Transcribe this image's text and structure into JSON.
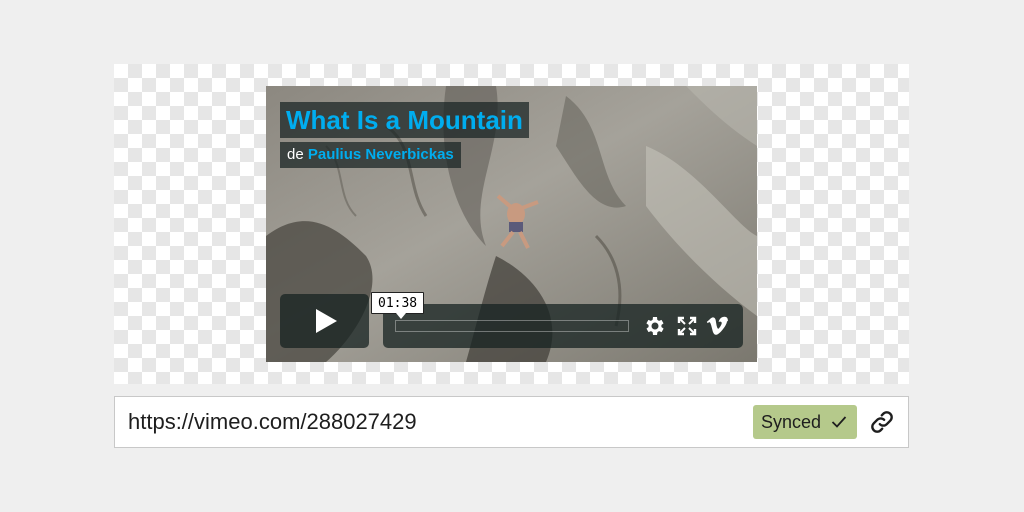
{
  "video": {
    "title": "What Is a Mountain",
    "byline_prefix": "de",
    "author": "Paulius Neverbickas",
    "timestamp": "01:38",
    "accent_color": "#00adef"
  },
  "controls": {
    "play_icon": "play-icon",
    "settings_icon": "gear-icon",
    "fullscreen_icon": "fullscreen-icon",
    "brand_icon": "vimeo-logo-icon"
  },
  "embed": {
    "url": "https://vimeo.com/288027429",
    "status_label": "Synced",
    "status_icon": "check-icon",
    "status_color": "#b5c98b",
    "link_icon": "link-icon"
  }
}
